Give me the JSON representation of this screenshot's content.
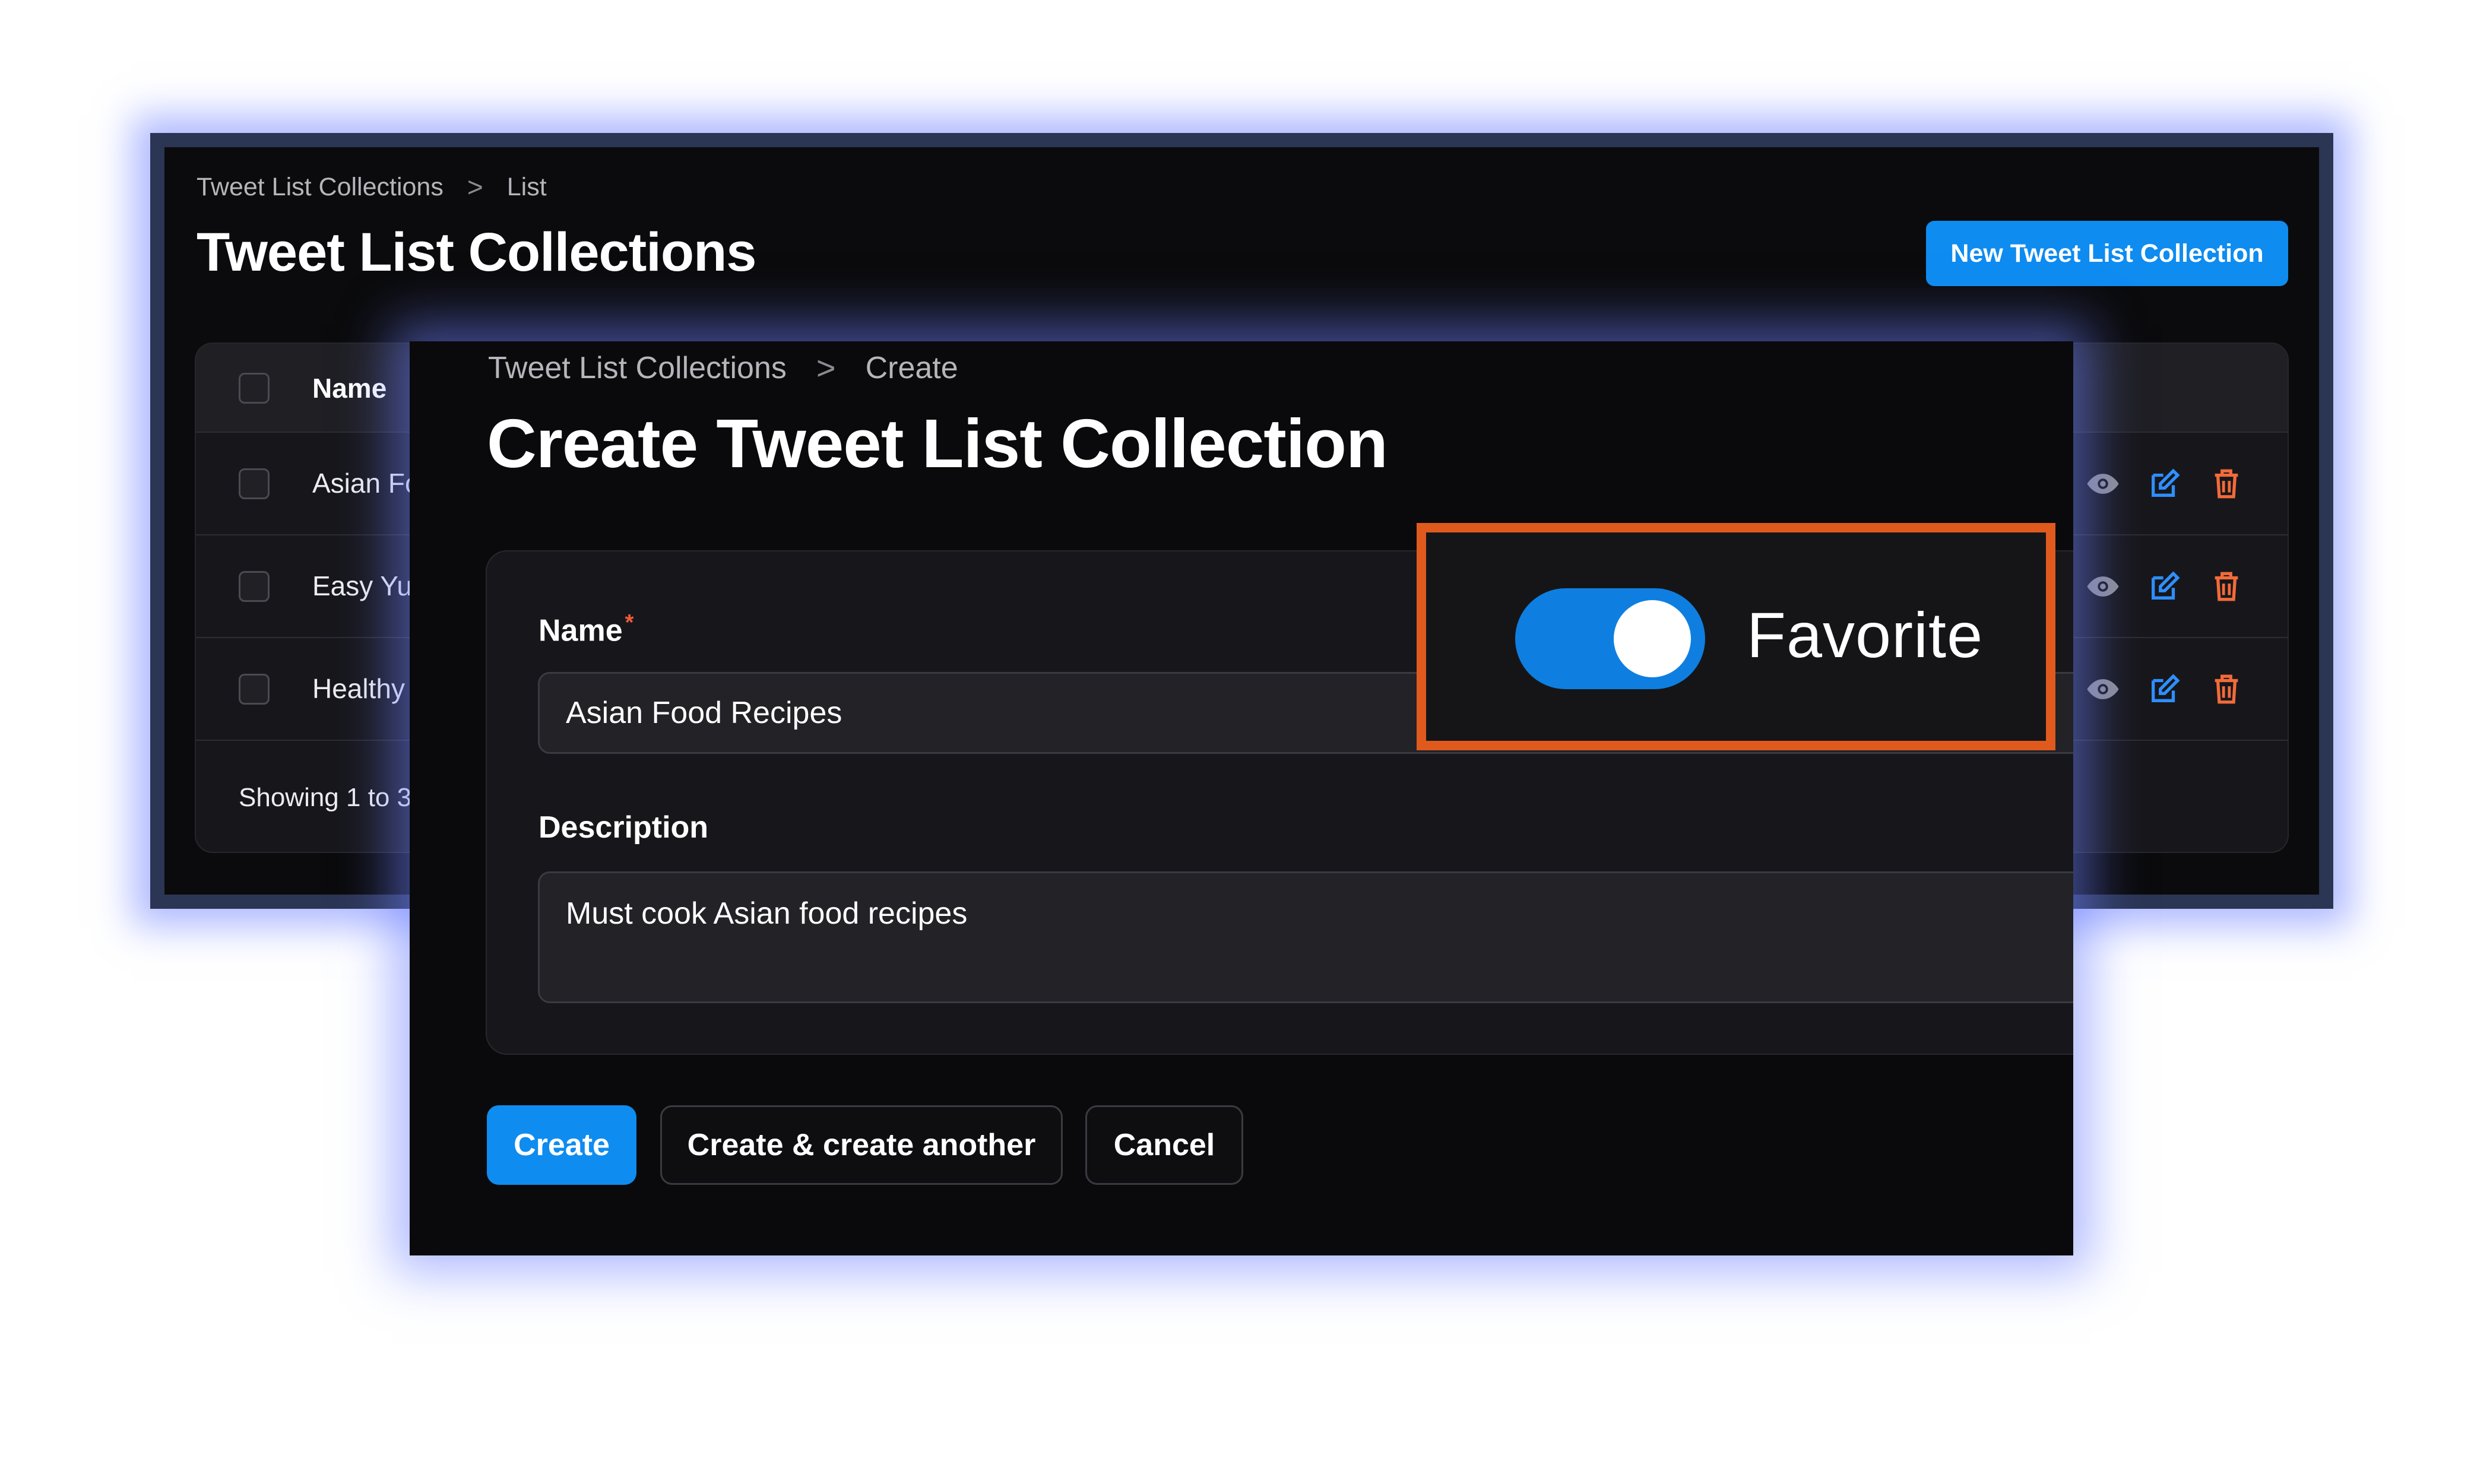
{
  "background_list": {
    "breadcrumb": [
      "Tweet List Collections",
      "List"
    ],
    "breadcrumb_separator": ">",
    "title": "Tweet List Collections",
    "new_button": "New Tweet List Collection",
    "table": {
      "header_name": "Name",
      "rows": [
        {
          "name": "Asian Fo"
        },
        {
          "name": "Easy Yu"
        },
        {
          "name": "Healthy"
        }
      ],
      "footer": "Showing 1 to 3",
      "row_action_icons": [
        "eye-icon",
        "edit-icon",
        "trash-icon"
      ]
    }
  },
  "form": {
    "breadcrumb": [
      "Tweet List Collections",
      "Create"
    ],
    "breadcrumb_separator": ">",
    "title": "Create Tweet List Collection",
    "name_label": "Name",
    "required_marker": "*",
    "name_value": "Asian Food Recipes",
    "description_label": "Description",
    "description_value": "Must cook Asian food recipes",
    "favorite_label": "Favorite",
    "favorite_on": true,
    "buttons": {
      "create": "Create",
      "create_another": "Create & create another",
      "cancel": "Cancel"
    }
  },
  "colors": {
    "accent": "#0e8cf0",
    "highlight": "#e05a1e",
    "danger_icon": "#f26b3a",
    "edit_icon": "#2f8fff"
  }
}
